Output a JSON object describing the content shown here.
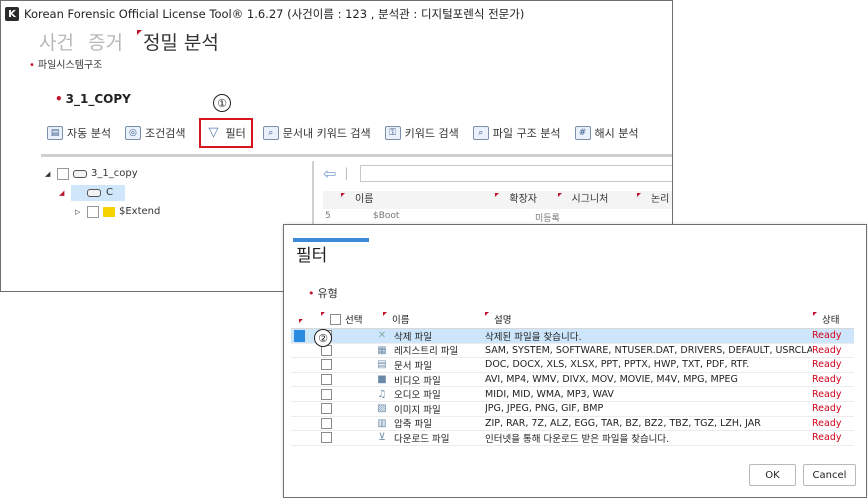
{
  "window": {
    "title": "Korean Forensic Official License Tool® 1.6.27 (사건이름 : 123 ,  분석관 : 디지털포렌식 전문가)",
    "app_icon": "K"
  },
  "nav": {
    "items": [
      {
        "label": "사건"
      },
      {
        "label": "증거"
      },
      {
        "label": "정밀 분석"
      }
    ]
  },
  "breadcrumb": "파일시스템구조",
  "case_title": "3_1_COPY",
  "markers": {
    "one": "①",
    "two": "②"
  },
  "toolbar": {
    "auto": "자동 분석",
    "condition": "조건검색",
    "filter": "필터",
    "keyword_in_doc": "문서내 키워드 검색",
    "keyword": "키워드 검색",
    "structure": "파일 구조 분석",
    "hash": "해시 분석"
  },
  "tree": {
    "root": "3_1_copy",
    "drive": "C",
    "extend": "$Extend"
  },
  "grid": {
    "columns": [
      "이름",
      "확장자",
      "시그니처",
      "논리"
    ],
    "partial_row": {
      "index": "5",
      "name": "$Boot",
      "sig": "미등록"
    }
  },
  "dialog": {
    "title": "필터",
    "section": "유형",
    "columns": {
      "select": "선택",
      "name": "이름",
      "desc": "설명",
      "status": "상태"
    },
    "rows": [
      {
        "checked": true,
        "icon": "delete-file-icon",
        "name": "삭제 파일",
        "desc": "삭제된 파일을 찾습니다.",
        "status": "Ready"
      },
      {
        "checked": false,
        "icon": "registry-file-icon",
        "name": "레지스트리 파일",
        "desc": "SAM, SYSTEM, SOFTWARE, NTUSER.DAT, DRIVERS, DEFAULT, USRCLASS.DAT",
        "status": "Ready"
      },
      {
        "checked": false,
        "icon": "document-file-icon",
        "name": "문서 파일",
        "desc": "DOC, DOCX, XLS, XLSX, PPT, PPTX, HWP, TXT, PDF, RTF.",
        "status": "Ready"
      },
      {
        "checked": false,
        "icon": "video-file-icon",
        "name": "비디오 파일",
        "desc": "AVI, MP4, WMV, DIVX, MOV, MOVIE, M4V, MPG, MPEG",
        "status": "Ready"
      },
      {
        "checked": false,
        "icon": "audio-file-icon",
        "name": "오디오 파일",
        "desc": "MIDI, MID, WMA, MP3, WAV",
        "status": "Ready"
      },
      {
        "checked": false,
        "icon": "image-file-icon",
        "name": "이미지 파일",
        "desc": "JPG, JPEG, PNG, GIF, BMP",
        "status": "Ready"
      },
      {
        "checked": false,
        "icon": "archive-file-icon",
        "name": "압축 파일",
        "desc": "ZIP, RAR, 7Z, ALZ, EGG, TAR, BZ, BZ2, TBZ, TGZ, LZH, JAR",
        "status": "Ready"
      },
      {
        "checked": false,
        "icon": "download-file-icon",
        "name": "다운로드 파일",
        "desc": "인터넷을 통해 다운로드 받은 파일을 찾습니다.",
        "status": "Ready"
      }
    ],
    "ok": "OK",
    "cancel": "Cancel"
  },
  "colors": {
    "accent": "#3b8ad6",
    "status": "#d0021b",
    "highlight_row": "#cde6fb",
    "filter_box": "#d9141e"
  }
}
